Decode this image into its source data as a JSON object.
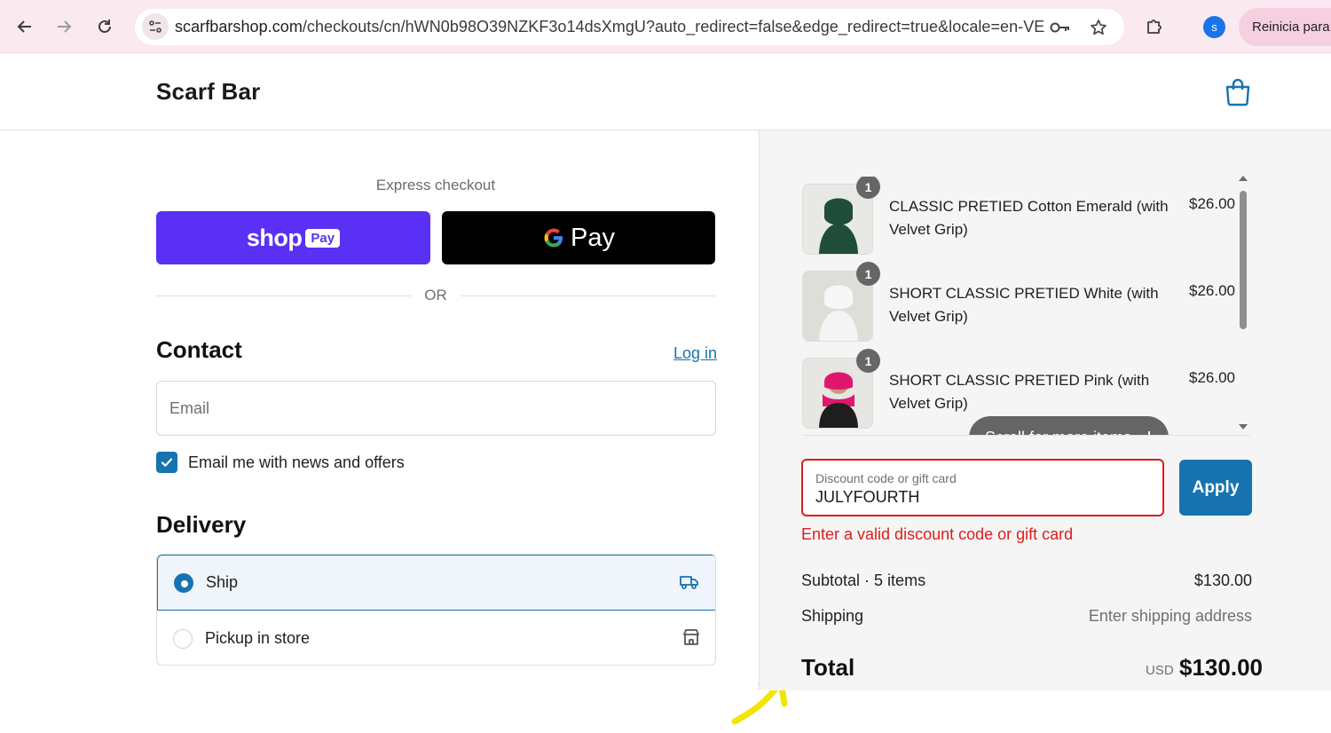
{
  "browser": {
    "url_domain": "scarfbarshop.com",
    "url_path": "/checkouts/cn/hWN0b98O39NZKF3o14dsXmgU?auto_redirect=false&edge_redirect=true&locale=en-VE&...",
    "profile_initial": "s",
    "reinicia_label": "Reinicia para a"
  },
  "header": {
    "brand": "Scarf Bar"
  },
  "express": {
    "label": "Express checkout",
    "shoppay_word": "shop",
    "shoppay_badge": "Pay",
    "gpay_word": "Pay",
    "or": "OR"
  },
  "contact": {
    "title": "Contact",
    "login": "Log in",
    "email_placeholder": "Email",
    "newsletter_label": "Email me with news and offers",
    "newsletter_checked": true
  },
  "delivery": {
    "title": "Delivery",
    "options": [
      {
        "label": "Ship",
        "selected": true,
        "icon": "truck-icon"
      },
      {
        "label": "Pickup in store",
        "selected": false,
        "icon": "store-icon"
      }
    ]
  },
  "cart": {
    "items": [
      {
        "name": "CLASSIC PRETIED Cotton Emerald (with Velvet Grip)",
        "qty": "1",
        "price": "$26.00",
        "color": "#1f4d3a"
      },
      {
        "name": "SHORT CLASSIC PRETIED White (with Velvet Grip)",
        "qty": "1",
        "price": "$26.00",
        "color": "#f2f2f2"
      },
      {
        "name": "SHORT CLASSIC PRETIED Pink (with Velvet Grip)",
        "qty": "1",
        "price": "$26.00",
        "color": "#e0176c"
      }
    ],
    "scroll_hint": "Scroll for more items"
  },
  "discount": {
    "label": "Discount code or gift card",
    "value": "JULYFOURTH",
    "apply": "Apply",
    "error": "Enter a valid discount code or gift card"
  },
  "summary": {
    "subtotal_label": "Subtotal · 5 items",
    "subtotal_value": "$130.00",
    "shipping_label": "Shipping",
    "shipping_value": "Enter shipping address",
    "total_label": "Total",
    "total_currency": "USD",
    "total_value": "$130.00"
  },
  "colors": {
    "accent": "#1773b0",
    "error": "#dd1d1d",
    "shoppay": "#5a31f4",
    "annotation": "#f2e500"
  }
}
